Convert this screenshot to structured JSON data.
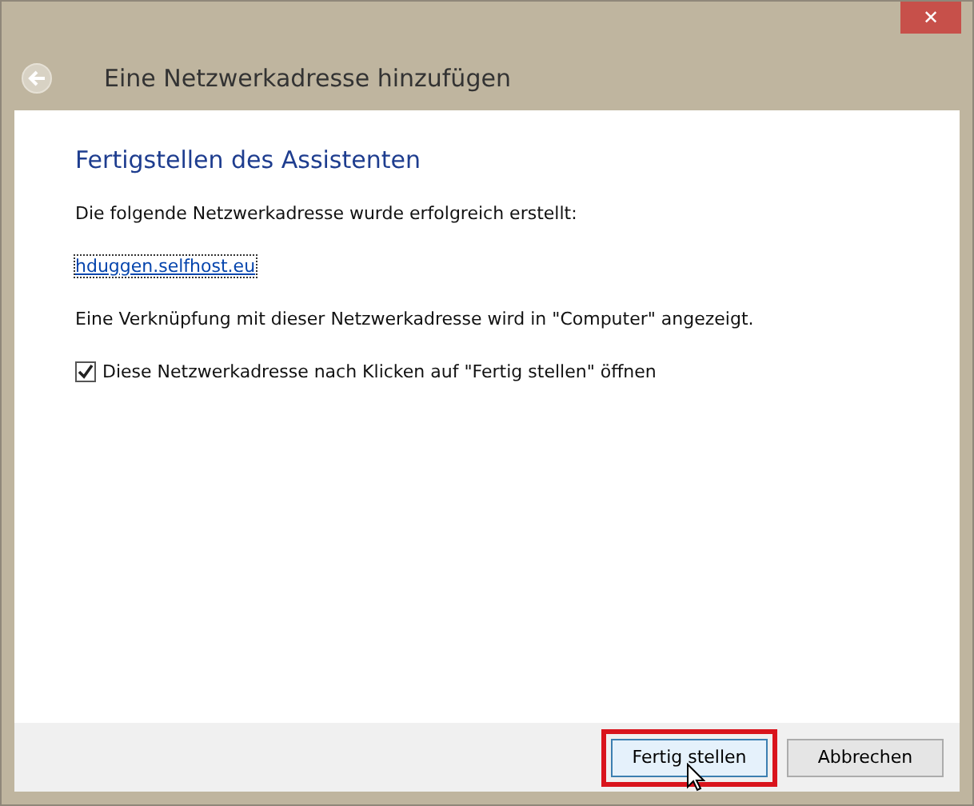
{
  "window": {
    "title": "Eine Netzwerkadresse hinzufügen",
    "close": "✕"
  },
  "heading": "Fertigstellen des Assistenten",
  "intro": "Die folgende Netzwerkadresse wurde erfolgreich erstellt:",
  "address_link": "hduggen.selfhost.eu",
  "note": "Eine Verknüpfung mit dieser Netzwerkadresse wird in \"Computer\" angezeigt.",
  "open_checkbox": {
    "label": "Diese Netzwerkadresse nach Klicken auf \"Fertig stellen\" öffnen",
    "checked": true
  },
  "buttons": [
    {
      "label": "Fertig stellen",
      "highlighted": true
    },
    {
      "label": "Abbrechen",
      "highlighted": false
    }
  ]
}
